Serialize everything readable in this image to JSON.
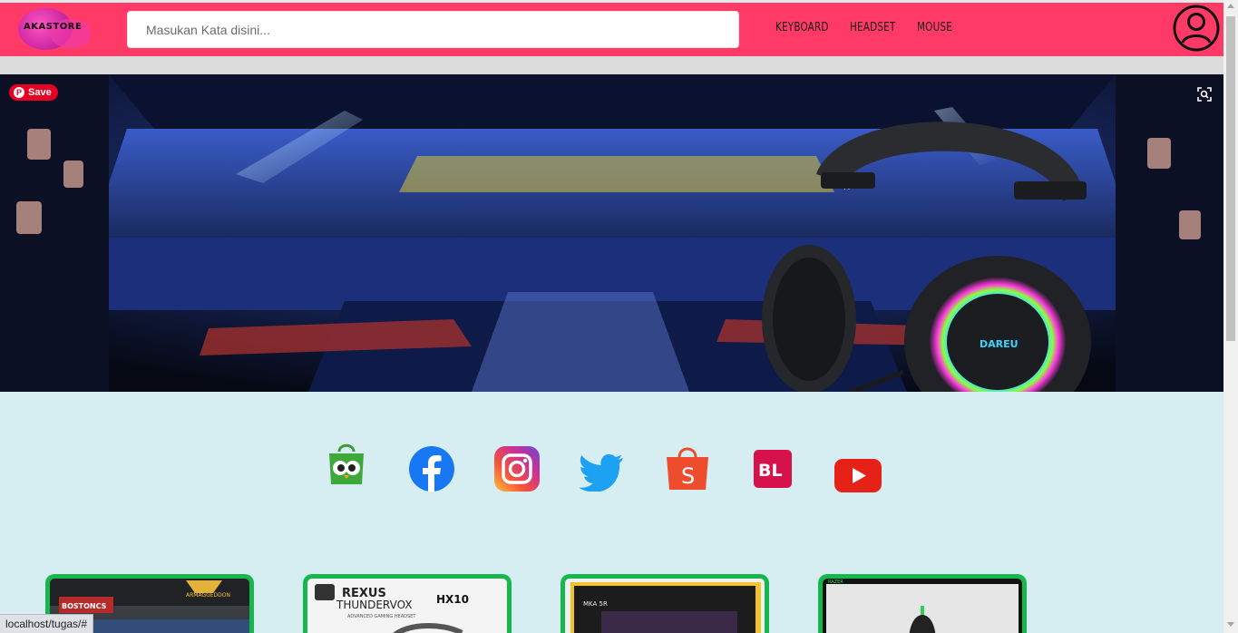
{
  "brand": {
    "logo_text": "AKASTORE"
  },
  "search": {
    "placeholder": "Masukan Kata disini..."
  },
  "nav": {
    "items": [
      "KEYBOARD",
      "HEADSET",
      "MOUSE"
    ]
  },
  "hero": {
    "pinterest_save_label": "Save",
    "headset_brand_text": "DAREU",
    "headset_side_label": "R"
  },
  "social_links": [
    "tokopedia-icon",
    "facebook-icon",
    "instagram-icon",
    "twitter-icon",
    "shopee-icon",
    "bukalapak-icon",
    "youtube-icon"
  ],
  "social_text": {
    "bukalapak": "BL",
    "shopee": "S"
  },
  "products": [
    {
      "brand_text": "BOSTONCS",
      "sub_text": "ARMAGGEDDON"
    },
    {
      "brand_text": "REXUS",
      "sub_text": "THUNDERVOX",
      "model_text": "HX10",
      "desc_text": "ADVANCED GAMING HEADSET"
    },
    {
      "brand_text": "MKA 5R"
    },
    {
      "brand_text": "RAZER"
    }
  ],
  "status_bar": {
    "url": "localhost/tugas/#"
  },
  "colors": {
    "header": "#ff3a66",
    "page_bg": "#d6eef2",
    "card_border": "#16b84d",
    "pinterest": "#e60023"
  }
}
